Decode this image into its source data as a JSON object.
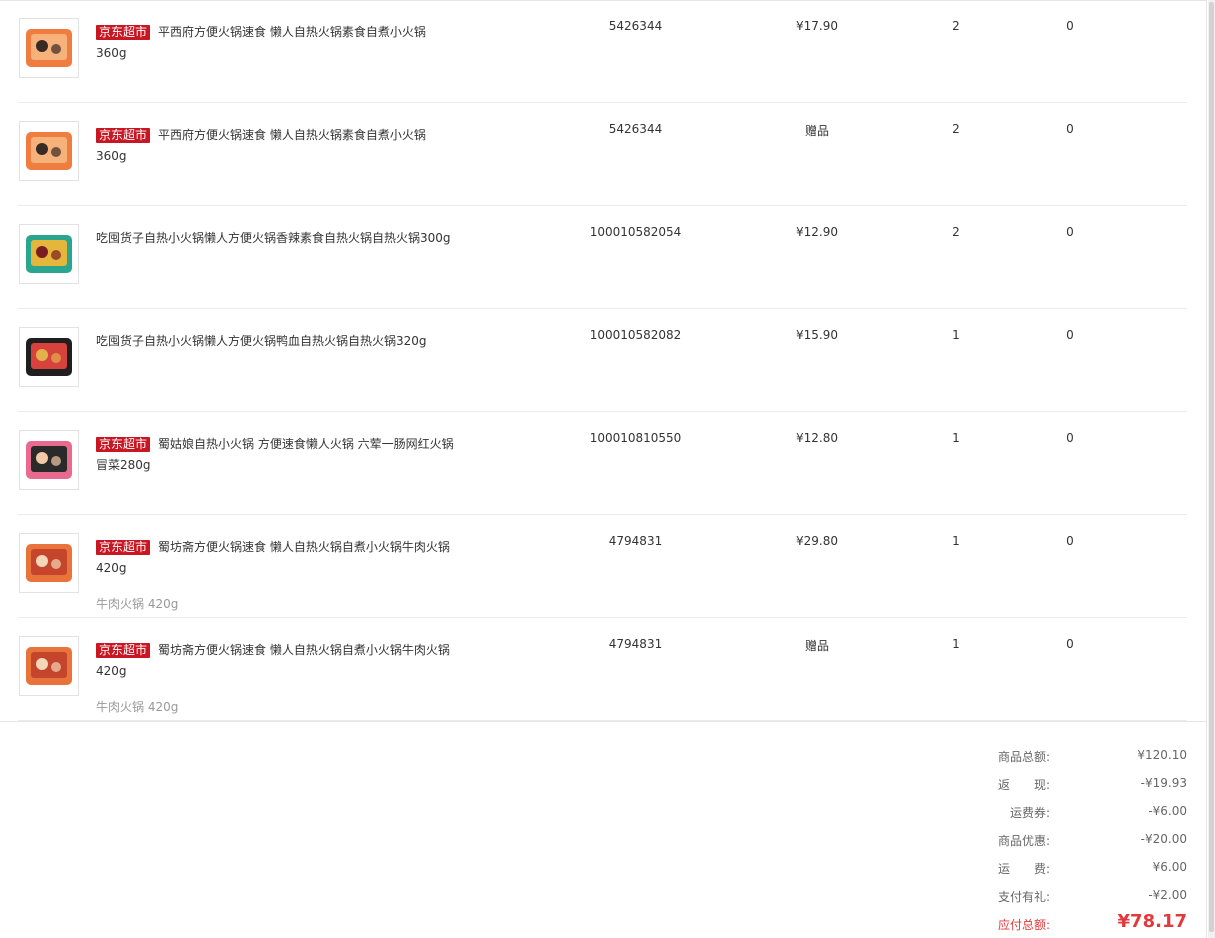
{
  "items": [
    {
      "tag": "京东超市",
      "name": "平西府方便火锅速食 懒人自热火锅素食自煮小火锅360g",
      "sub": "",
      "sku": "5426344",
      "price": "¥17.90",
      "qty": "2",
      "returned": "0",
      "thumb_icon": "hotpot-box-image"
    },
    {
      "tag": "京东超市",
      "name": "平西府方便火锅速食 懒人自热火锅素食自煮小火锅360g",
      "sub": "",
      "sku": "5426344",
      "price": "赠品",
      "qty": "2",
      "returned": "0",
      "thumb_icon": "hotpot-box-image"
    },
    {
      "tag": "",
      "name": "吃囤货子自热小火锅懒人方便火锅香辣素食自热火锅自热火锅300g",
      "sub": "",
      "sku": "100010582054",
      "price": "¥12.90",
      "qty": "2",
      "returned": "0",
      "thumb_icon": "hotpot-green-box-image"
    },
    {
      "tag": "",
      "name": "吃囤货子自热小火锅懒人方便火锅鸭血自热火锅自热火锅320g",
      "sub": "",
      "sku": "100010582082",
      "price": "¥15.90",
      "qty": "1",
      "returned": "0",
      "thumb_icon": "hotpot-dark-box-image"
    },
    {
      "tag": "京东超市",
      "name": "蜀姑娘自热小火锅 方便速食懒人火锅 六荤一肠网红火锅冒菜280g",
      "sub": "",
      "sku": "100010810550",
      "price": "¥12.80",
      "qty": "1",
      "returned": "0",
      "thumb_icon": "hotpot-pink-box-image"
    },
    {
      "tag": "京东超市",
      "name": "蜀坊斋方便火锅速食 懒人自热火锅自煮小火锅牛肉火锅 420g",
      "sub": "牛肉火锅 420g",
      "sku": "4794831",
      "price": "¥29.80",
      "qty": "1",
      "returned": "0",
      "thumb_icon": "beef-hotpot-image"
    },
    {
      "tag": "京东超市",
      "name": "蜀坊斋方便火锅速食 懒人自热火锅自煮小火锅牛肉火锅 420g",
      "sub": "牛肉火锅 420g",
      "sku": "4794831",
      "price": "赠品",
      "qty": "1",
      "returned": "0",
      "thumb_icon": "beef-hotpot-image"
    }
  ],
  "summary": {
    "goods_total_label": "商品总额:",
    "goods_total": "¥120.10",
    "cashback_label": "返　　现:",
    "cashback": "-¥19.93",
    "shipping_coupon_label": "运费券:",
    "shipping_coupon": "-¥6.00",
    "discount_label": "商品优惠:",
    "discount": "-¥20.00",
    "shipping_label": "运　　费:",
    "shipping": "¥6.00",
    "gift_label": "支付有礼:",
    "gift": "-¥2.00",
    "payable_label": "应付总额:",
    "payable": "¥78.17"
  },
  "colors": {
    "tag_red": "#c81623",
    "pay_red": "#e4393c"
  }
}
